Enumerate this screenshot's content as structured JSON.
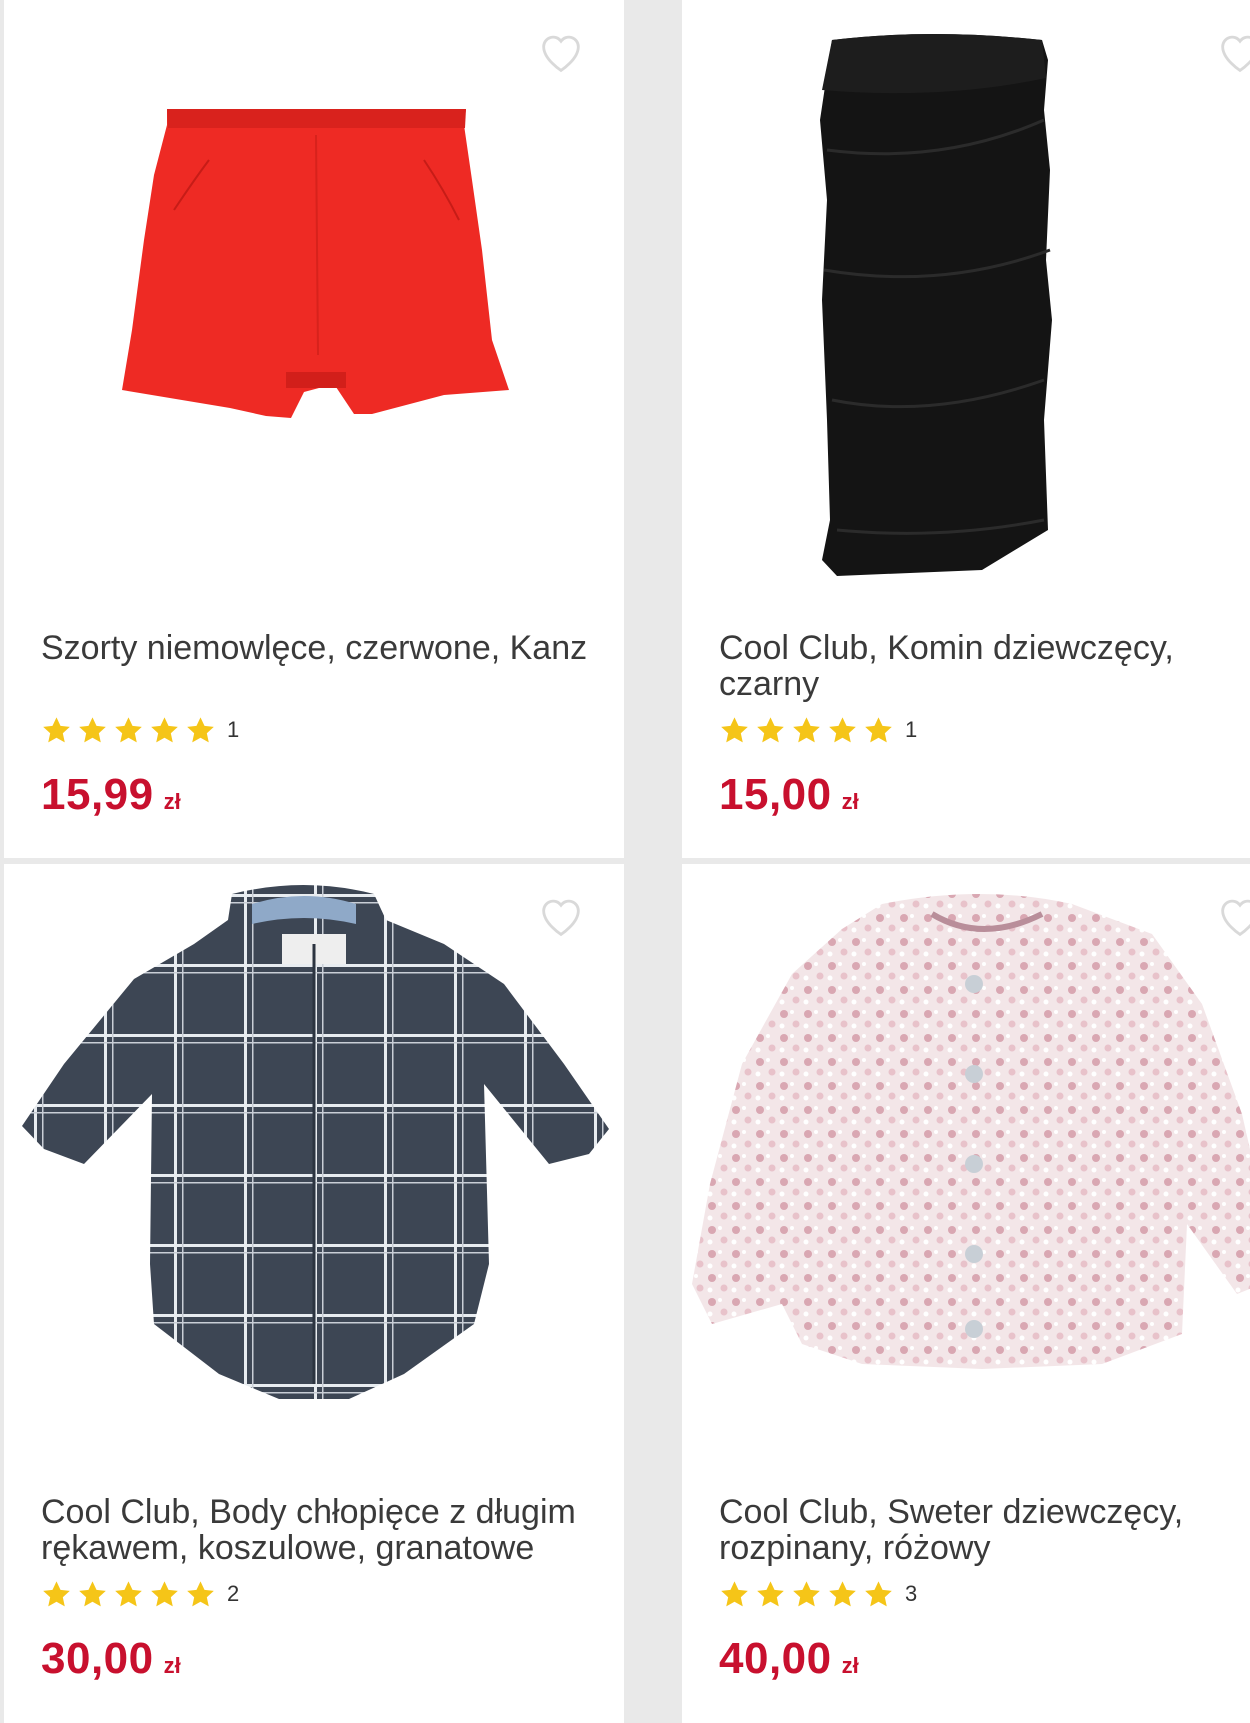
{
  "colors": {
    "price": "#c8102e",
    "star": "#f5c518",
    "heart_outline": "#d9d9d9"
  },
  "products": [
    {
      "title": "Szorty niemowlęce, czerwone, Kanz",
      "rating_count": "1",
      "rating_stars": 5,
      "price": "15,99",
      "currency": "zł",
      "image": "red-shorts-image"
    },
    {
      "title": "Cool Club, Komin dziewczęcy, czarny",
      "rating_count": "1",
      "rating_stars": 5,
      "price": "15,00",
      "currency": "zł",
      "image": "black-neck-warmer-image"
    },
    {
      "title": "Cool Club, Body chłopięce z długim rękawem, koszulowe, granatowe",
      "rating_count": "2",
      "rating_stars": 5,
      "price": "30,00",
      "currency": "zł",
      "image": "plaid-shirt-bodysuit-image"
    },
    {
      "title": "Cool Club, Sweter dziewczęcy, rozpinany, różowy",
      "rating_count": "3",
      "rating_stars": 5,
      "price": "40,00",
      "currency": "zł",
      "image": "pink-cardigan-image"
    }
  ]
}
